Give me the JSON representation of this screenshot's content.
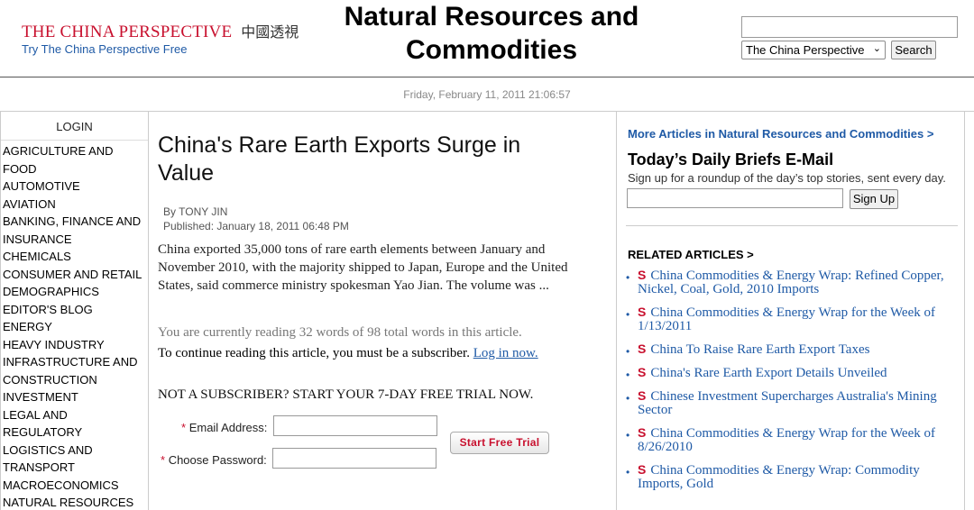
{
  "header": {
    "logo_text": "THE CHINA PERSPECTIVE",
    "logo_cn": "中國透視",
    "logo_link": "Try The China Perspective Free",
    "title": "Natural Resources and Commodities",
    "search_placeholder": "",
    "search_scope": "The China Perspective",
    "search_button": "Search"
  },
  "datebar": {
    "text": "Friday, February 11, 2011 21:06:57"
  },
  "sidebar": {
    "login": "LOGIN",
    "items": [
      "AGRICULTURE AND FOOD",
      "AUTOMOTIVE",
      "AVIATION",
      "BANKING, FINANCE AND INSURANCE",
      "CHEMICALS",
      "CONSUMER AND RETAIL",
      "DEMOGRAPHICS",
      "EDITOR'S BLOG",
      "ENERGY",
      "HEAVY INDUSTRY",
      "INFRASTRUCTURE AND CONSTRUCTION",
      "INVESTMENT",
      "LEGAL AND REGULATORY",
      "LOGISTICS AND TRANSPORT",
      "MACROECONOMICS",
      "NATURAL RESOURCES"
    ]
  },
  "article": {
    "title": "China's Rare Earth Exports Surge in Value",
    "author": "By TONY JIN",
    "published": "Published: January 18, 2011 06:48 PM",
    "excerpt": "China exported 35,000 tons of rare earth elements between January and November 2010, with the majority shipped to Japan, Europe and the United States, said commerce ministry spokesman Yao Jian. The volume was ...",
    "reading": "You are currently reading 32 words of 98 total words in this article.",
    "continue_text": "To continue reading this article, you must be a subscriber. ",
    "login_link": "Log in now.",
    "trial_heading": "NOT A SUBSCRIBER? START YOUR 7-DAY FREE TRIAL NOW.",
    "required_mark": "*",
    "email_label": "Email Address:",
    "password_label": "Choose Password:",
    "trial_button": "Start Free Trial"
  },
  "right": {
    "more_link": "More Articles in Natural Resources and Commodities >",
    "briefs_title": "Today’s Daily Briefs E-Mail",
    "briefs_desc": "Sign up for a roundup of the day’s top stories, sent every day.",
    "signup_button": "Sign Up",
    "related_heading": "RELATED ARTICLES >",
    "related": [
      "China Commodities & Energy Wrap: Refined Copper, Nickel, Coal, Gold, 2010 Imports",
      "China Commodities & Energy Wrap for the Week of 1/13/2011",
      "China To Raise Rare Earth Export Taxes",
      "China's Rare Earth Export Details Unveiled",
      "Chinese Investment Supercharges Australia's Mining Sector",
      "China Commodities & Energy Wrap for the Week of 8/26/2010",
      "China Commodities & Energy Wrap: Commodity Imports, Gold"
    ]
  },
  "icons": {
    "related_bullet": "•",
    "related_icon": "S",
    "chevron": "⌄"
  },
  "colors": {
    "brand_red": "#c8102e",
    "link_blue": "#1f5aa6"
  }
}
